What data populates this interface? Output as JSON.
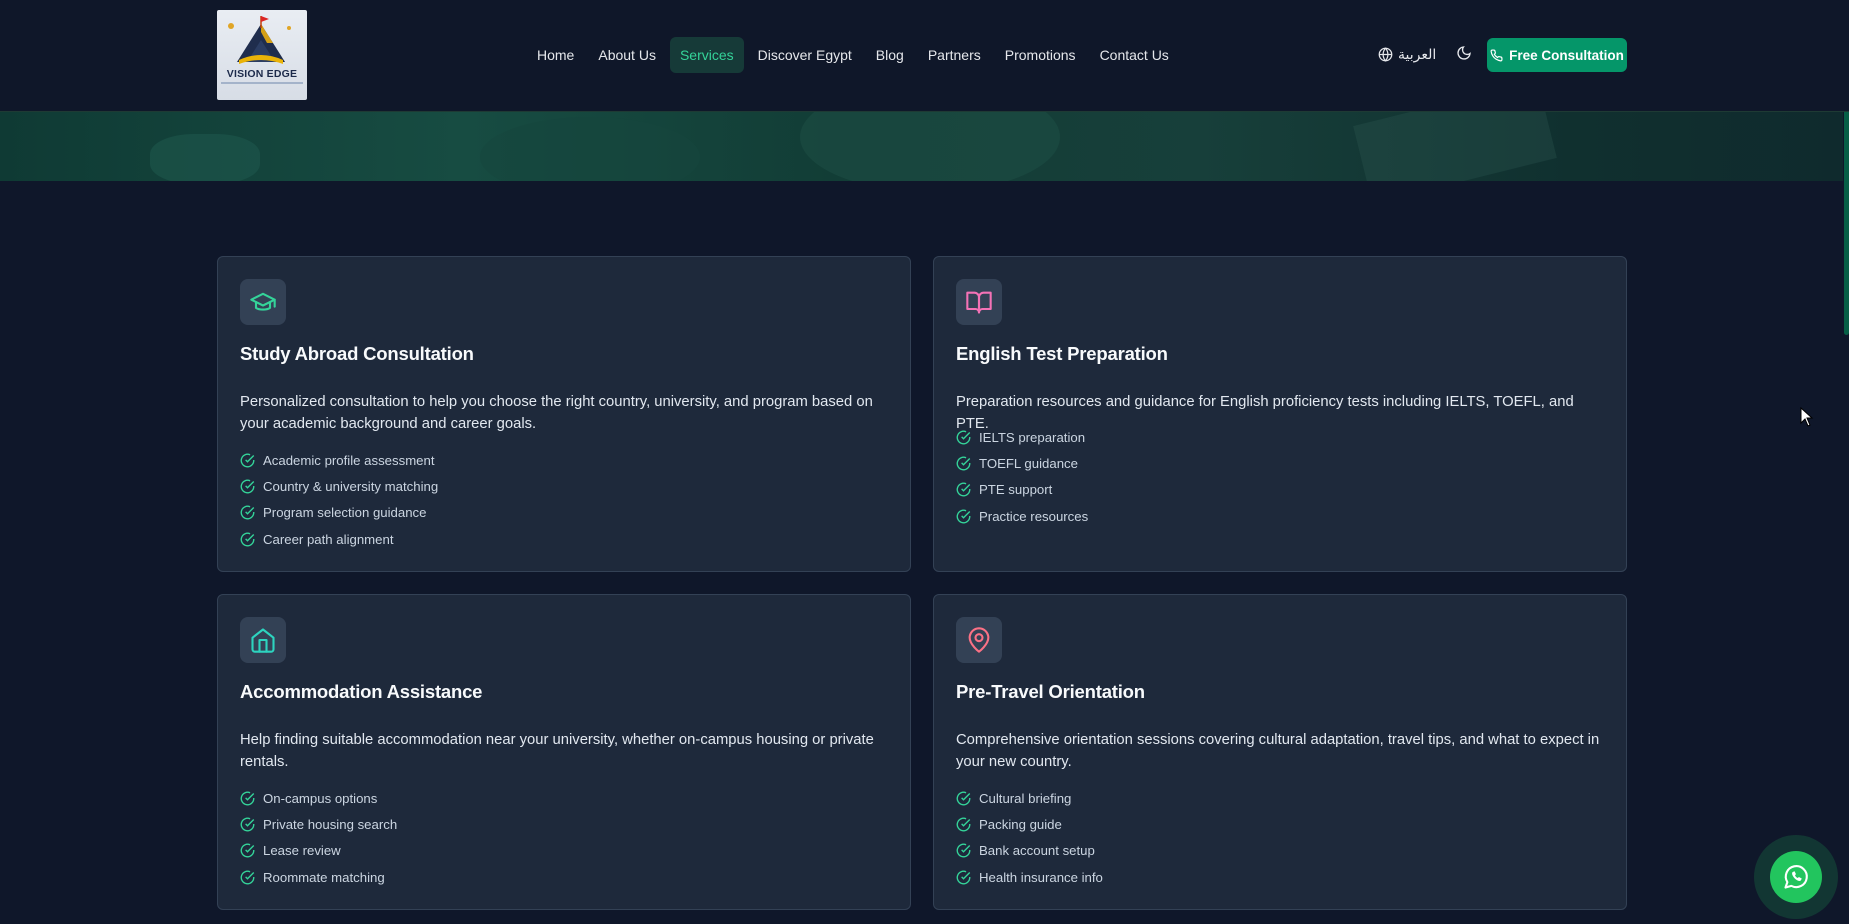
{
  "header": {
    "logo": {
      "text": "VISION EDGE"
    },
    "nav": [
      {
        "label": "Home"
      },
      {
        "label": "About Us"
      },
      {
        "label": "Services"
      },
      {
        "label": "Discover Egypt"
      },
      {
        "label": "Blog"
      },
      {
        "label": "Partners"
      },
      {
        "label": "Promotions"
      },
      {
        "label": "Contact Us"
      }
    ],
    "active_nav": "Services",
    "language_label": "العربية",
    "cta_label": "Free Consultation"
  },
  "services": [
    {
      "icon": "graduation-cap-icon",
      "icon_color": "#34d399",
      "title": "Study Abroad Consultation",
      "description": "Personalized consultation to help you choose the right country, university, and program based on your academic background and career goals.",
      "features": [
        "Academic profile assessment",
        "Country & university matching",
        "Program selection guidance",
        "Career path alignment"
      ]
    },
    {
      "icon": "book-open-icon",
      "icon_color": "#f472b6",
      "title": "English Test Preparation",
      "description": "Preparation resources and guidance for English proficiency tests including IELTS, TOEFL, and PTE.",
      "features": [
        "IELTS preparation",
        "TOEFL guidance",
        "PTE support",
        "Practice resources"
      ]
    },
    {
      "icon": "home-icon",
      "icon_color": "#2dd4bf",
      "title": "Accommodation Assistance",
      "description": "Help finding suitable accommodation near your university, whether on-campus housing or private rentals.",
      "features": [
        "On-campus options",
        "Private housing search",
        "Lease review",
        "Roommate matching"
      ]
    },
    {
      "icon": "map-pin-icon",
      "icon_color": "#fb7185",
      "title": "Pre-Travel Orientation",
      "description": "Comprehensive orientation sessions covering cultural adaptation, travel tips, and what to expect in your new country.",
      "features": [
        "Cultural briefing",
        "Packing guide",
        "Bank account setup",
        "Health insurance info"
      ]
    }
  ],
  "colors": {
    "accent": "#059669",
    "check": "#34d399",
    "background": "#0f172a",
    "card": "#1e293b"
  }
}
